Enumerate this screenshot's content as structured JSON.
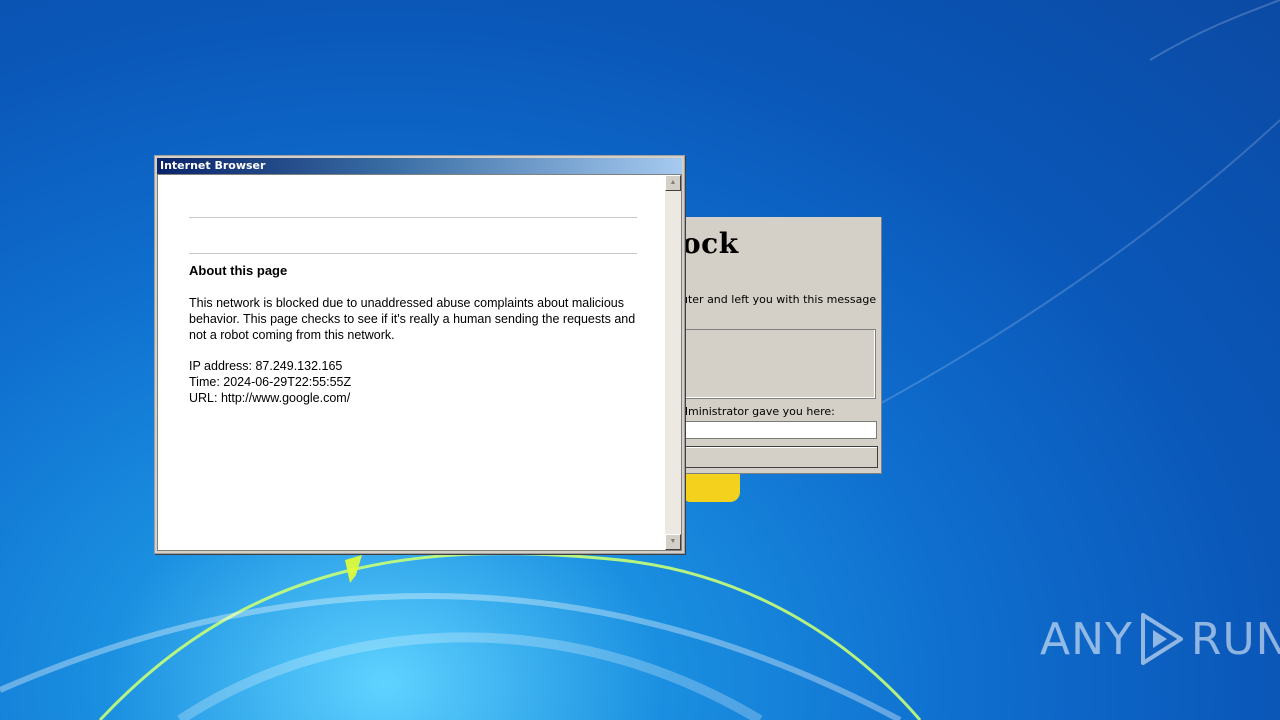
{
  "background_window": {
    "title_fragment": "ock",
    "message_fragment": "uter and left you with this message",
    "label_fragment": "dministrator gave you here:",
    "input_value": "",
    "button_label": ""
  },
  "browser_window": {
    "title": "Internet Browser",
    "page": {
      "heading": "About this page",
      "body": "This network is blocked due to unaddressed abuse complaints about malicious behavior. This page checks to see if it's really a human sending the requests and not a robot coming from this network.",
      "ip_line": "IP address: 87.249.132.165",
      "time_line": "Time: 2024-06-29T22:55:55Z",
      "url_line": "URL: http://www.google.com/"
    }
  },
  "watermark": {
    "left_text": "ANY",
    "right_text": "RUN",
    "icon": "play-triangle-icon"
  }
}
